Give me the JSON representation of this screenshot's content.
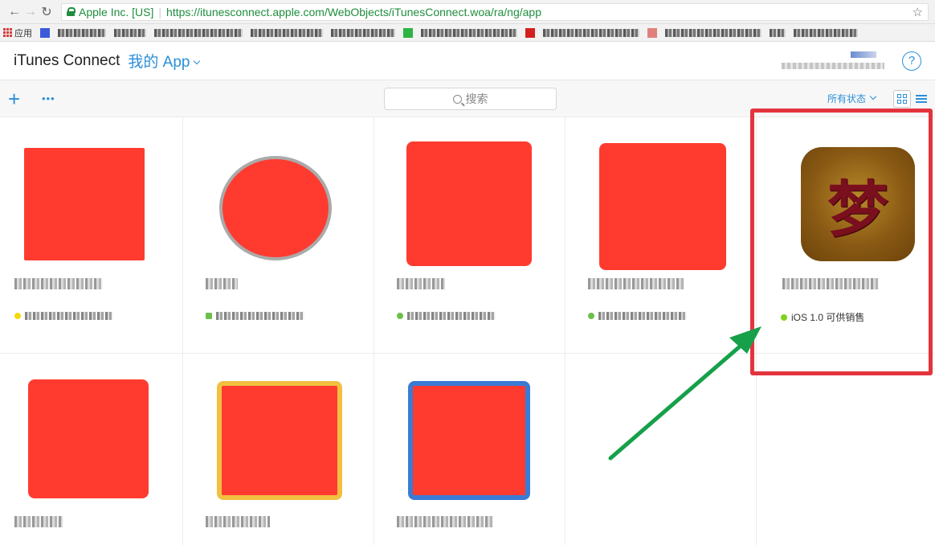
{
  "browser": {
    "back": "←",
    "forward": "→",
    "reload": "↻",
    "site_name": "Apple Inc. [US]",
    "url_host": "https://itunesconnect.apple.com",
    "url_path": "/WebObjects/iTunesConnect.woa/ra/ng/app",
    "star": "☆",
    "apps_label": "应用"
  },
  "header": {
    "title": "iTunes Connect",
    "menu_label": "我的 App",
    "help": "?"
  },
  "toolbar": {
    "add": "+",
    "more": "•••",
    "search_placeholder": "搜索",
    "status_filter": "所有状态"
  },
  "apps": [
    {
      "status_color": "#f5d90a"
    },
    {
      "status_color": "#6cc04a"
    },
    {
      "status_color": "#6cc04a"
    },
    {
      "status_color": "#6cc04a"
    },
    {
      "icon_char": "梦",
      "status_color": "#7ed321",
      "platform": "iOS",
      "version": "1.0",
      "status": "可供销售"
    },
    {},
    {},
    {}
  ],
  "colors": {
    "accent": "#2b8fd9",
    "highlight": "#e3343e",
    "arrow": "#16a04a",
    "redaction": "#ff3b30"
  }
}
